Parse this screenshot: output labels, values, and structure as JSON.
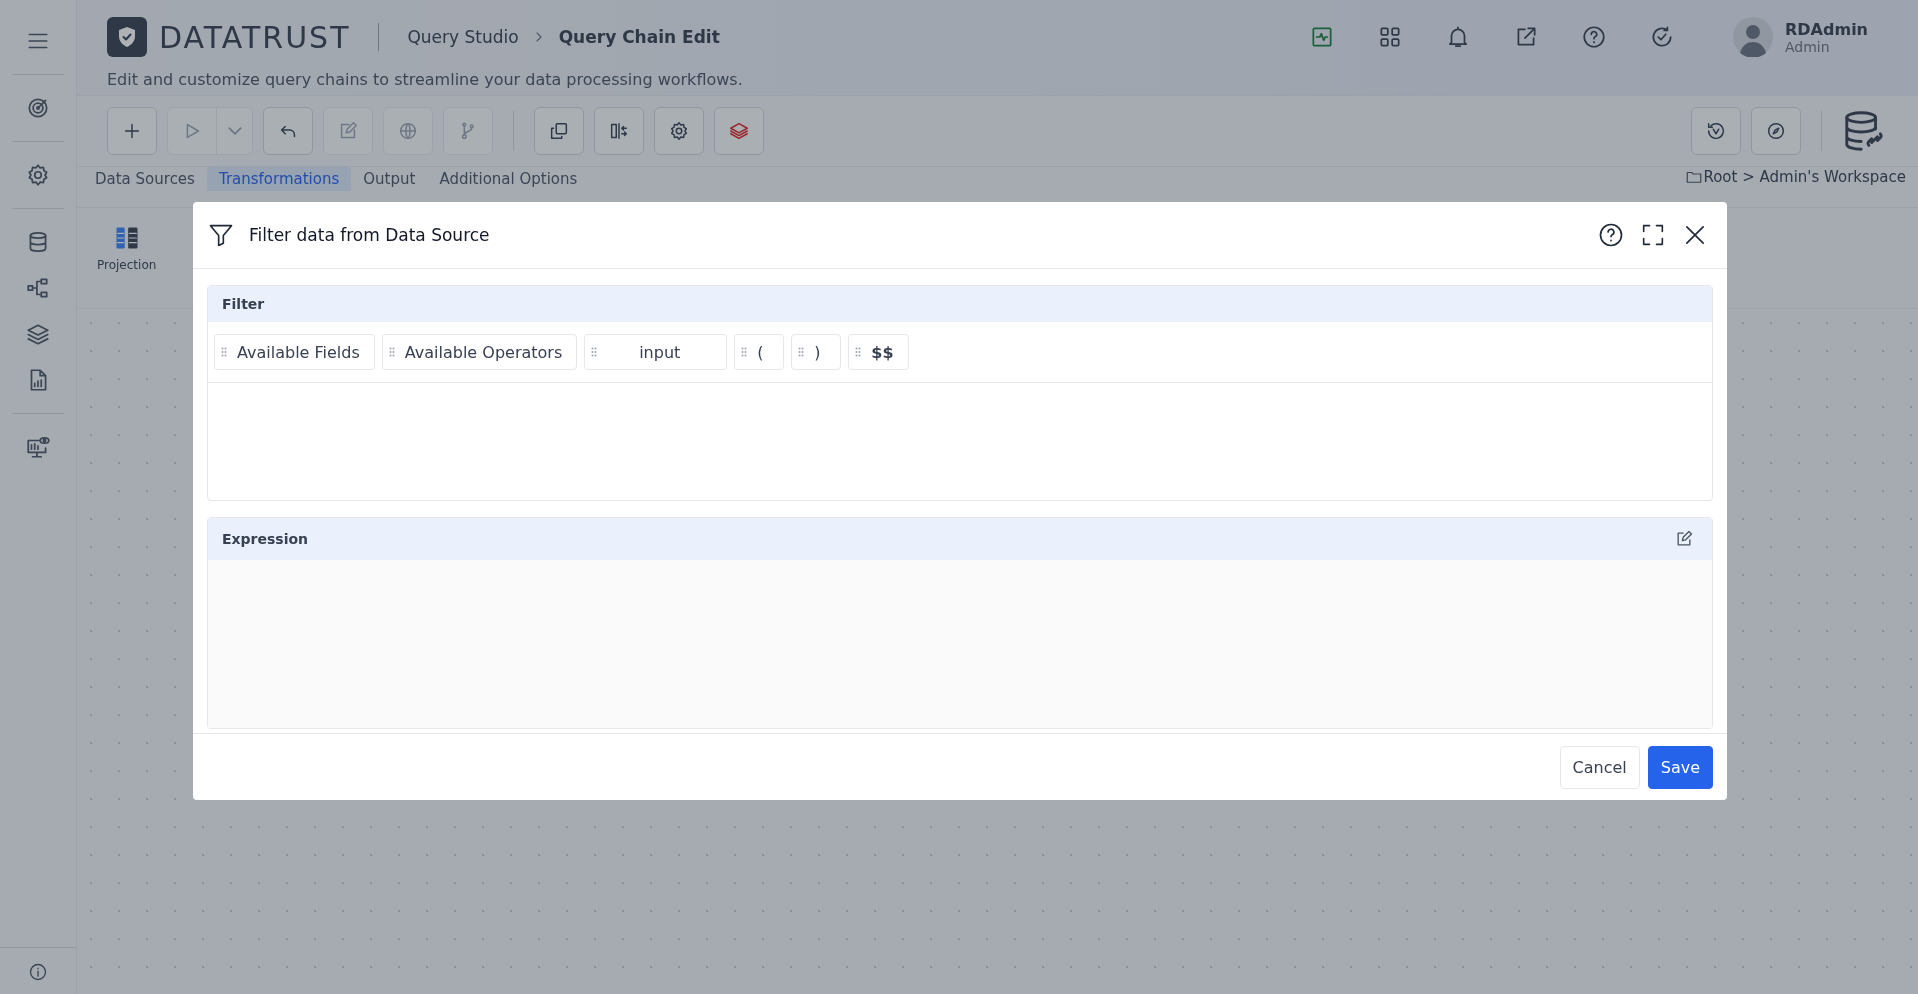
{
  "header": {
    "logo_text": "DATATRUST",
    "breadcrumb": [
      {
        "label": "Query Studio",
        "current": false
      },
      {
        "label": "Query Chain Edit",
        "current": true
      }
    ],
    "subtitle": "Edit and customize query chains to streamline your data processing workflows.",
    "user": {
      "name": "RDAdmin",
      "role": "Admin"
    }
  },
  "toolbar": [
    {
      "kind": "add",
      "disabled": false
    },
    {
      "kind": "run",
      "disabled": true
    },
    {
      "kind": "undo",
      "disabled": false
    },
    {
      "kind": "edit",
      "disabled": true
    },
    {
      "kind": "globe",
      "disabled": true
    },
    {
      "kind": "branch",
      "disabled": true
    },
    {
      "kind": "copy",
      "disabled": false
    },
    {
      "kind": "compare",
      "disabled": false
    },
    {
      "kind": "settings",
      "disabled": false
    },
    {
      "kind": "layers",
      "disabled": false
    }
  ],
  "tabs": [
    {
      "label": "Data Sources",
      "selected": false
    },
    {
      "label": "Transformations",
      "selected": true
    },
    {
      "label": "Output",
      "selected": false
    },
    {
      "label": "Additional Options",
      "selected": false
    }
  ],
  "location": "Root > Admin's Workspace",
  "palette": [
    {
      "label": "Projection"
    }
  ],
  "dialog": {
    "title": "Filter data from Data Source",
    "sections": [
      {
        "kind": "filter",
        "title": "Filter",
        "chips": [
          {
            "label": "Available Fields",
            "kind": "menu"
          },
          {
            "label": "Available Operators",
            "kind": "menu"
          },
          {
            "label": "input",
            "kind": "input"
          },
          {
            "label": "(",
            "kind": "symbol"
          },
          {
            "label": ")",
            "kind": "symbol"
          },
          {
            "label": "$$",
            "kind": "variable"
          }
        ]
      },
      {
        "kind": "expression",
        "title": "Expression"
      }
    ],
    "buttons": [
      {
        "label": "Cancel",
        "kind": "secondary"
      },
      {
        "label": "Save",
        "kind": "primary"
      }
    ]
  }
}
